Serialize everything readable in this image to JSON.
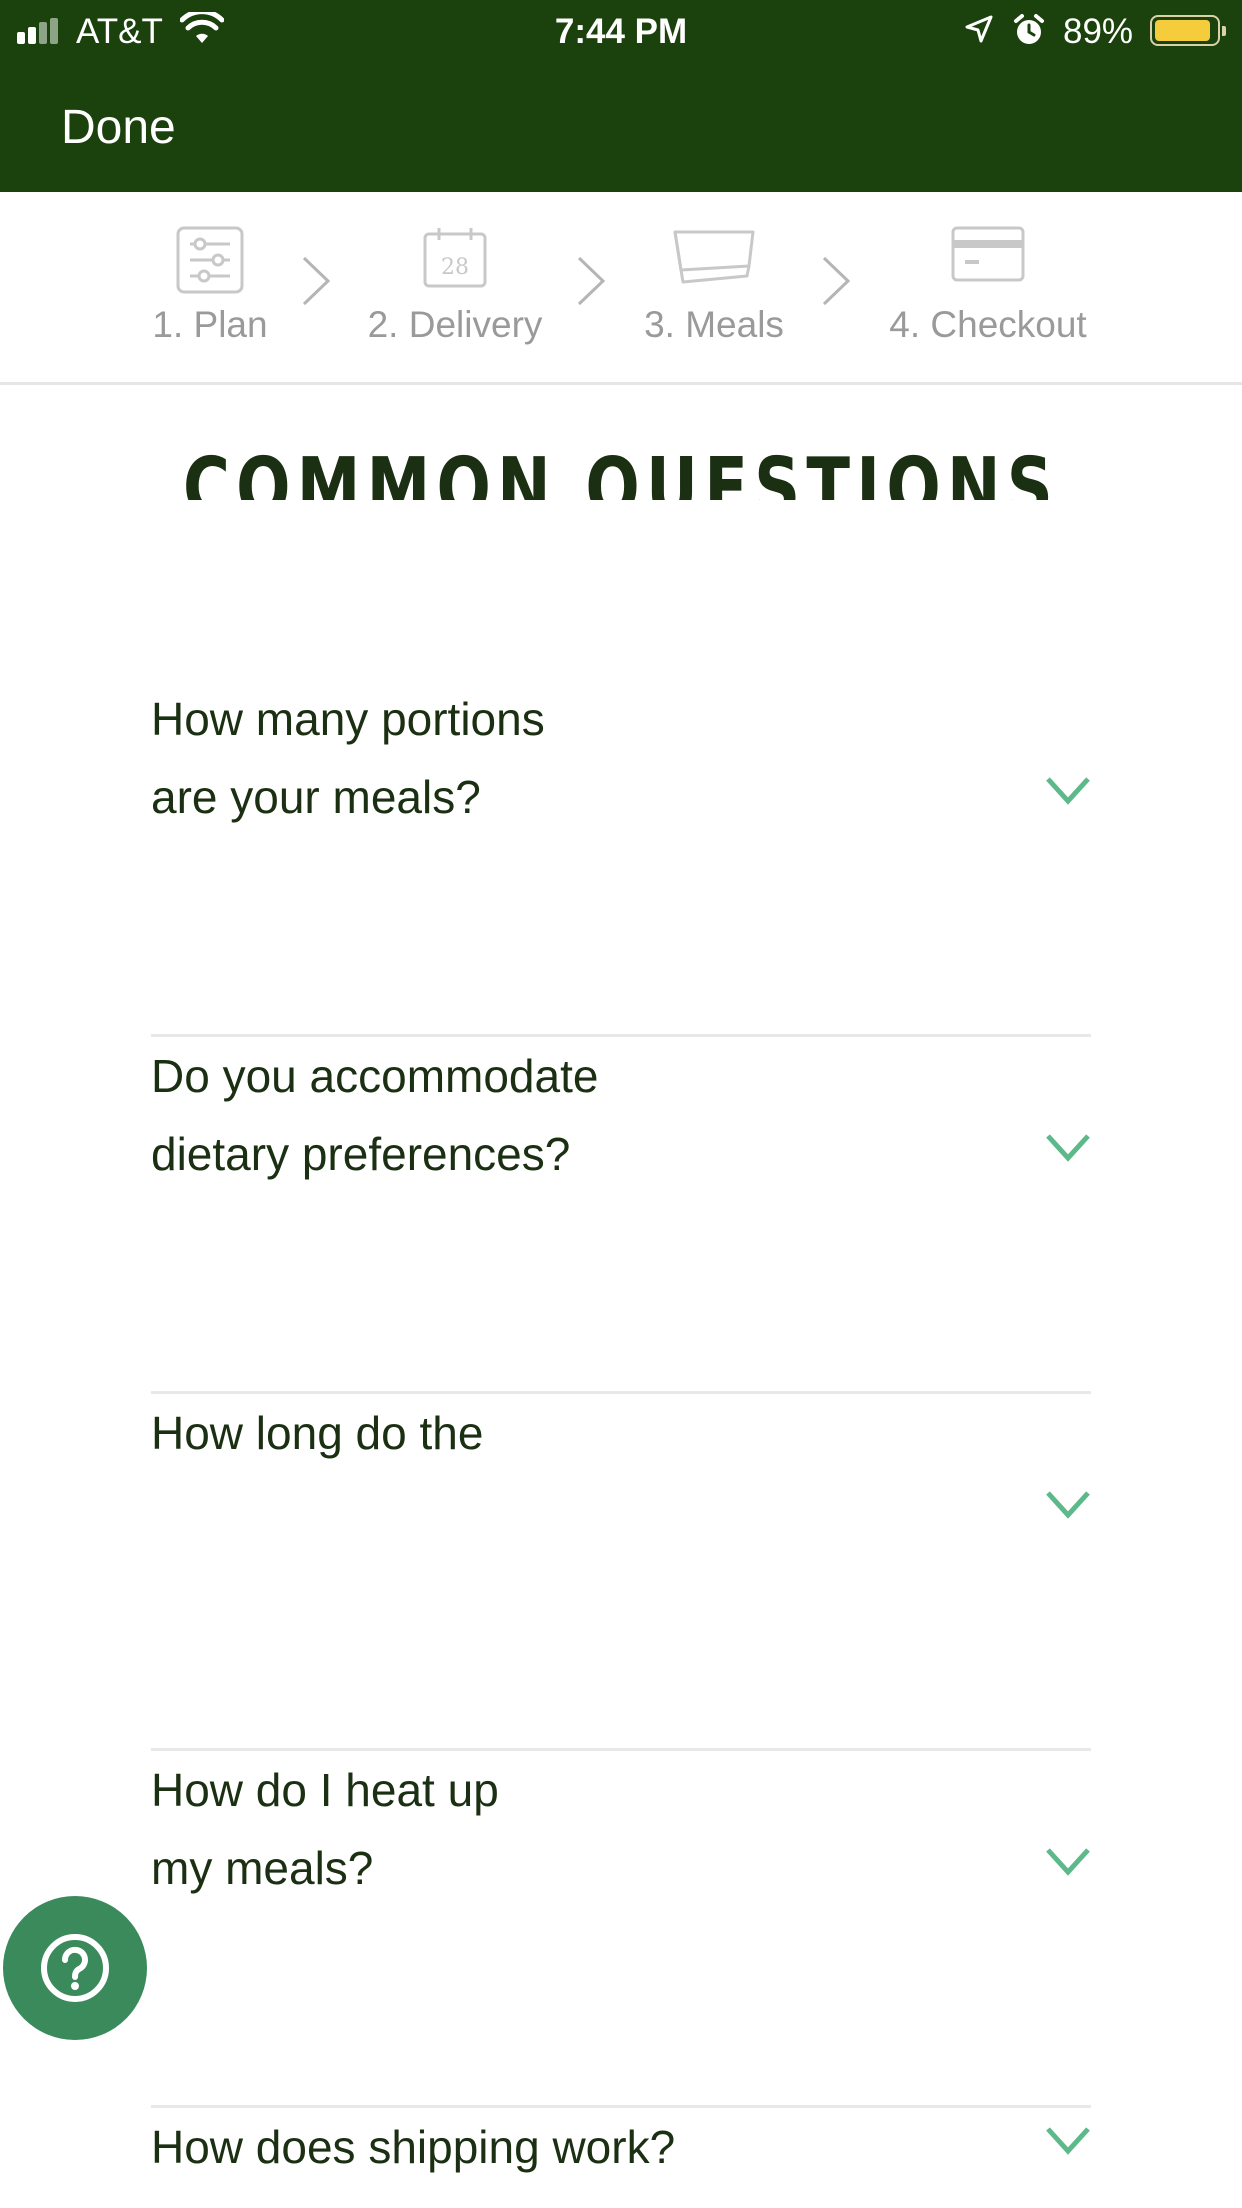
{
  "status_bar": {
    "carrier": "AT&T",
    "time": "7:44 PM",
    "battery_percent": "89%",
    "battery_level": 0.89,
    "icons": [
      "signal-icon",
      "wifi-icon",
      "location-icon",
      "alarm-icon",
      "battery-icon"
    ]
  },
  "nav": {
    "done_label": "Done"
  },
  "steps": [
    {
      "label": "1. Plan",
      "icon": "sliders-icon",
      "calendar_day": ""
    },
    {
      "label": "2. Delivery",
      "icon": "calendar-icon",
      "calendar_day": "28"
    },
    {
      "label": "3. Meals",
      "icon": "meal-tray-icon",
      "calendar_day": ""
    },
    {
      "label": "4. Checkout",
      "icon": "credit-card-icon",
      "calendar_day": ""
    }
  ],
  "heading": "COMMON QUESTIONS",
  "faq": [
    {
      "question_line1": "How many portions",
      "question_line2": "are your meals?"
    },
    {
      "question_line1": "Do you accommodate",
      "question_line2": "dietary preferences?"
    },
    {
      "question_line1": "How long do the",
      "question_line2": ""
    },
    {
      "question_line1": "How do I heat up",
      "question_line2": "my meals?"
    },
    {
      "question_line1": "How does shipping work?",
      "question_line2": ""
    }
  ],
  "colors": {
    "header_bg": "#1b410c",
    "text_dark": "#1b2f12",
    "chevron": "#5db98a",
    "help_bg": "#3a8a5c",
    "step_gray": "#9a9a9a"
  }
}
